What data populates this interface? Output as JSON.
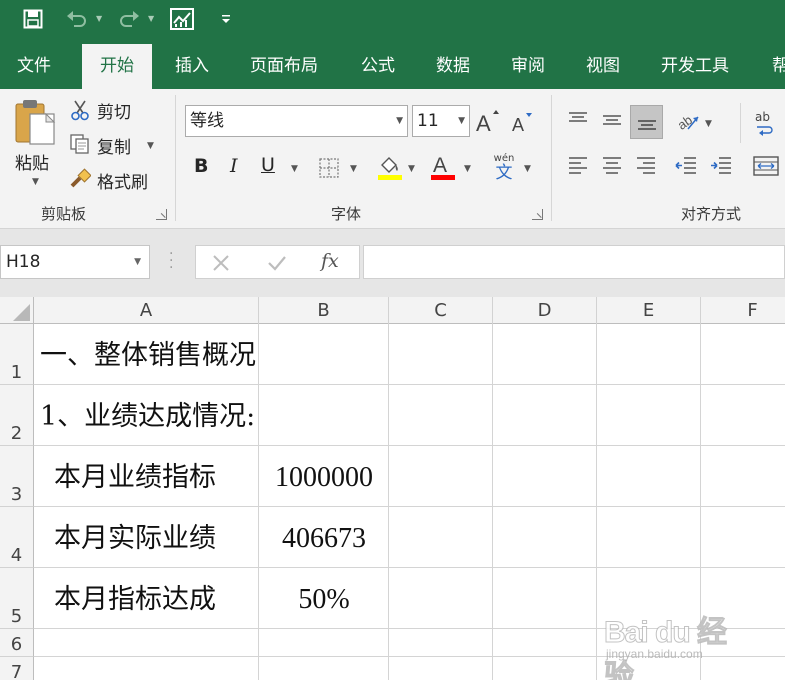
{
  "colors": {
    "accent": "#217346",
    "ribbon_bg": "#f3f3f3",
    "formula_bg": "#e6e6e6",
    "font_highlight": "#ffff00",
    "font_color": "#ff0000"
  },
  "qat": {
    "icons": [
      "save-icon",
      "undo-icon",
      "redo-icon",
      "chart-icon",
      "customize-icon"
    ]
  },
  "tabs": [
    {
      "label": "文件"
    },
    {
      "label": "开始"
    },
    {
      "label": "插入"
    },
    {
      "label": "页面布局"
    },
    {
      "label": "公式"
    },
    {
      "label": "数据"
    },
    {
      "label": "审阅"
    },
    {
      "label": "视图"
    },
    {
      "label": "开发工具"
    },
    {
      "label": "帮"
    }
  ],
  "clipboard": {
    "paste": "粘贴",
    "cut": "剪切",
    "copy": "复制",
    "format_painter": "格式刷",
    "label": "剪贴板"
  },
  "font": {
    "name": "等线",
    "size": "11",
    "label": "字体",
    "bold": "B",
    "italic": "I",
    "underline": "U",
    "font_color_glyph": "A",
    "wen": "wén",
    "wen_char": "文"
  },
  "alignment": {
    "label": "对齐方式",
    "wrap_ab": "ab"
  },
  "formula_bar": {
    "name_box": "H18",
    "fx": "fx",
    "value": ""
  },
  "grid": {
    "columns": [
      "A",
      "B",
      "C",
      "D",
      "E",
      "F"
    ],
    "rows": [
      "1",
      "2",
      "3",
      "4",
      "5",
      "6",
      "7"
    ],
    "cells": {
      "A1": "一、整体销售概况",
      "A2": "1、业绩达成情况:",
      "A3": "本月业绩指标",
      "B3": "1000000",
      "A4": "本月实际业绩",
      "B4": "406673",
      "A5": "本月指标达成",
      "B5": "50%"
    }
  },
  "watermark": {
    "brand": "Bai du 经验",
    "url": "jingyan.baidu.com"
  }
}
